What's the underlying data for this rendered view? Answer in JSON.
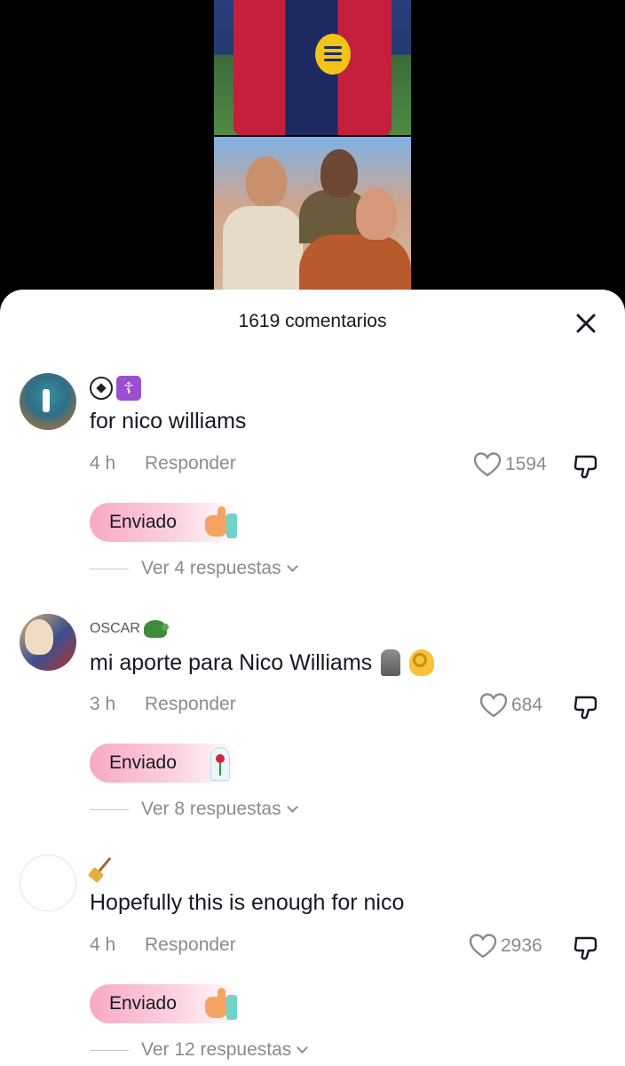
{
  "sheet": {
    "title": "1619 comentarios"
  },
  "comments": [
    {
      "username": "",
      "username_emojis": [
        "soccer-ball",
        "orthodox-cross"
      ],
      "text": "for nico williams",
      "text_emojis": [],
      "time": "4 h",
      "reply_label": "Responder",
      "likes": "1594",
      "gift_label": "Enviado",
      "gift_icon": "thumbs-up-gift",
      "replies_label": "Ver 4 respuestas"
    },
    {
      "username": "OSCAR",
      "username_emojis": [
        "turtle"
      ],
      "text": "mi aporte para Nico Williams",
      "text_emojis": [
        "moai",
        "ok-hand"
      ],
      "time": "3 h",
      "reply_label": "Responder",
      "likes": "684",
      "gift_label": "Enviado",
      "gift_icon": "rose-dome-gift",
      "replies_label": "Ver 8 respuestas"
    },
    {
      "username": "",
      "username_emojis": [
        "broom"
      ],
      "text": "Hopefully this is enough for nico",
      "text_emojis": [],
      "time": "4 h",
      "reply_label": "Responder",
      "likes": "2936",
      "gift_label": "Enviado",
      "gift_icon": "thumbs-up-gift",
      "replies_label": "Ver 12 respuestas"
    }
  ],
  "colors": {
    "text_primary": "#161823",
    "text_secondary": "#8a8b91",
    "gift_pill": "#f7a9c4"
  }
}
